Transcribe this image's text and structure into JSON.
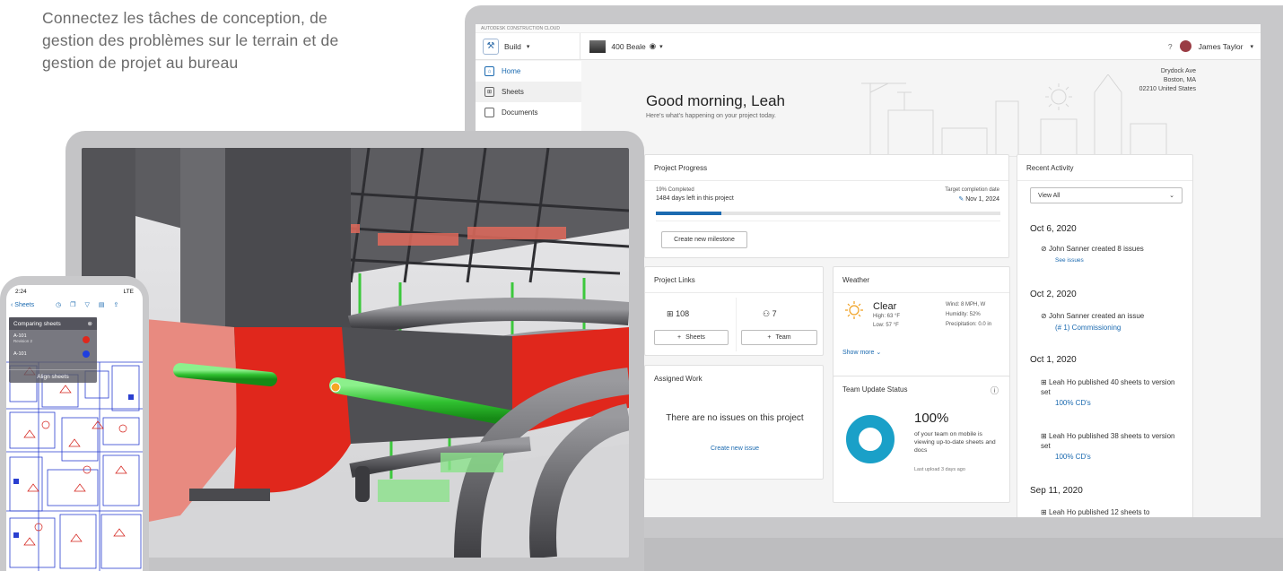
{
  "tagline": "Connectez les tâches de conception, de gestion des problèmes sur le terrain et de gestion de projet au bureau",
  "app": {
    "brand_strip": "AUTODESK CONSTRUCTION CLOUD",
    "module": "Build",
    "project": "400 Beale",
    "user": "James Taylor"
  },
  "sidebar": {
    "items": [
      {
        "label": "Home",
        "icon": "home-icon"
      },
      {
        "label": "Sheets",
        "icon": "sheets-icon"
      },
      {
        "label": "Documents",
        "icon": "documents-icon"
      }
    ]
  },
  "home": {
    "greeting": "Good morning, Leah",
    "subtitle": "Here's what's happening on your project today.",
    "address": [
      "Drydock Ave",
      "Boston, MA",
      "02210 United States"
    ]
  },
  "progress": {
    "title": "Project Progress",
    "completed_label": "19% Completed",
    "days_left": "1484 days left in this project",
    "target_label": "Target completion date",
    "target_date": "Nov 1, 2024",
    "percent": 19,
    "button": "Create new milestone"
  },
  "links": {
    "title": "Project Links",
    "sheets_count": "108",
    "team_count": "7",
    "sheets_button": "Sheets",
    "team_button": "Team"
  },
  "weather": {
    "title": "Weather",
    "condition": "Clear",
    "high": "High: 63 °F",
    "low": "Low: 57 °F",
    "wind": "Wind: 8 MPH, W",
    "humidity": "Humidity: 52%",
    "precipitation": "Precipitation: 0.0 in",
    "show_more": "Show more"
  },
  "assigned": {
    "title": "Assigned Work",
    "empty": "There are no issues on this project",
    "create": "Create new issue"
  },
  "team_status": {
    "title": "Team Update Status",
    "percent_label": "100%",
    "percent": 100,
    "description": "of your team on mobile is viewing up-to-date sheets and docs",
    "last_upload": "Last upload 3 days ago"
  },
  "activity": {
    "title": "Recent Activity",
    "filter": "View All",
    "groups": [
      {
        "date": "Oct 6, 2020",
        "entries": [
          {
            "text": "John Sanner created 8 issues",
            "link": "See issues"
          }
        ]
      },
      {
        "date": "Oct 2, 2020",
        "entries": [
          {
            "text": "John Sanner created an issue",
            "link": "(# 1) Commissioning"
          }
        ]
      },
      {
        "date": "Oct 1, 2020",
        "entries": [
          {
            "text": "Leah Ho published 40 sheets to version set",
            "link": "100% CD's"
          },
          {
            "text": "Leah Ho published 38 sheets to version set",
            "link": "100% CD's"
          }
        ]
      },
      {
        "date": "Sep 11, 2020",
        "entries": [
          {
            "text": "Leah Ho published 12 sheets to",
            "link": ""
          }
        ]
      }
    ]
  },
  "phone": {
    "time": "2:24",
    "signal": "LTE",
    "back": "Sheets",
    "panel_title": "Comparing sheets",
    "row1": "A-101",
    "row1_sub": "Revision 2",
    "row2": "A-101",
    "align": "Align sheets"
  },
  "colors": {
    "accent": "#1b6ab0",
    "progress": "#1b6ab0",
    "donut": "#1aa0c8",
    "duct_red": "#e0271c",
    "pipe_green": "#3cc83c"
  }
}
